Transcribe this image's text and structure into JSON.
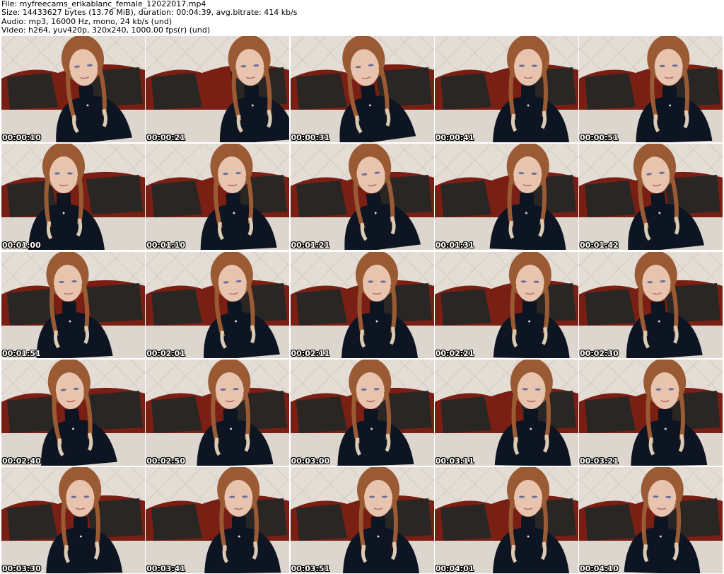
{
  "header": {
    "file_line": "File: myfreecams_erikablanc_female_12022017.mp4",
    "size_line": "Size: 14433627 bytes (13.76 MiB), duration: 00:04:39, avg.bitrate: 414 kb/s",
    "audio_line": "Audio: mp3, 16000 Hz, mono, 24 kb/s (und)",
    "video_line": "Video: h264, yuv420p, 320x240, 1000.00 fps(r) (und)"
  },
  "thumbnails": [
    {
      "timestamp": "00:00:10"
    },
    {
      "timestamp": "00:00:21"
    },
    {
      "timestamp": "00:00:31"
    },
    {
      "timestamp": "00:00:41"
    },
    {
      "timestamp": "00:00:51"
    },
    {
      "timestamp": "00:01:00"
    },
    {
      "timestamp": "00:01:10"
    },
    {
      "timestamp": "00:01:21"
    },
    {
      "timestamp": "00:01:31"
    },
    {
      "timestamp": "00:01:42"
    },
    {
      "timestamp": "00:01:51"
    },
    {
      "timestamp": "00:02:01"
    },
    {
      "timestamp": "00:02:11"
    },
    {
      "timestamp": "00:02:21"
    },
    {
      "timestamp": "00:02:30"
    },
    {
      "timestamp": "00:02:40"
    },
    {
      "timestamp": "00:02:50"
    },
    {
      "timestamp": "00:03:00"
    },
    {
      "timestamp": "00:03:11"
    },
    {
      "timestamp": "00:03:21"
    },
    {
      "timestamp": "00:03:30"
    },
    {
      "timestamp": "00:03:41"
    },
    {
      "timestamp": "00:03:51"
    },
    {
      "timestamp": "00:04:01"
    },
    {
      "timestamp": "00:04:10"
    }
  ],
  "colors": {
    "wall": "#e4ddd6",
    "headboard": "#7a1f14",
    "pillow": "#2a2624",
    "bedsheet": "#ddd6cf",
    "sweater": "#0d1422",
    "skin": "#e8c4ae",
    "hair": "#9a5a34",
    "braid": "#d9cbb4"
  }
}
